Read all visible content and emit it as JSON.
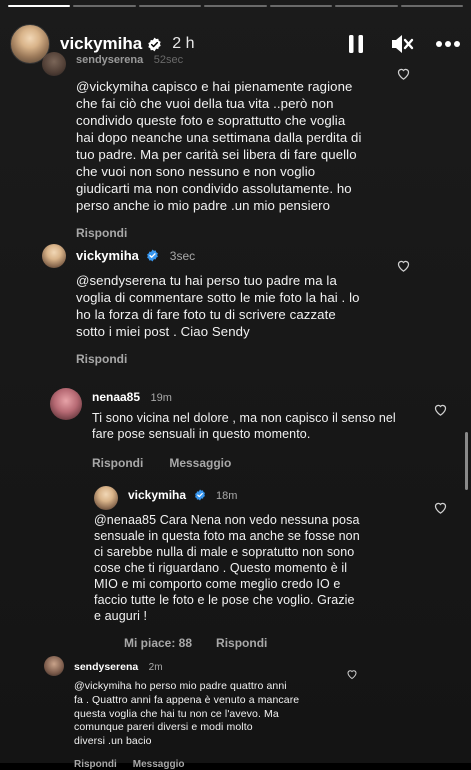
{
  "story": {
    "username": "vickymiha",
    "time": "2 h",
    "progress_segments": 7,
    "progress_current": 1
  },
  "comments": [
    {
      "user": "sendyserena",
      "time": "52sec",
      "text": "@vickymiha capisco e hai pienamente ragione\nche fai ciò che vuoi della tua vita ..però non\ncondivido queste foto e soprattutto che voglia\nhai dopo neanche una settimana dalla perdita di\ntuo padre. Ma per carità sei libera di fare quello\nche vuoi non sono nessuno e non voglio\ngiudicarti ma non condivido assolutamente. ho\nperso anche io mio padre .un mio pensiero",
      "reply_label": "Rispondi"
    },
    {
      "user": "vickymiha",
      "time": "3sec",
      "text": "@sendyserena tu hai perso tuo padre ma la\nvoglia di commentare sotto le mie foto la hai . lo\nho la forza di fare foto tu di scrivere cazzate\nsotto i miei post . Ciao Sendy",
      "reply_label": "Rispondi"
    },
    {
      "user": "nenaa85",
      "time": "19m",
      "text": "Ti sono vicina nel dolore , ma non capisco il senso nel\nfare pose sensuali in questo momento.",
      "reply_label": "Rispondi",
      "message_label": "Messaggio"
    },
    {
      "user": "vickymiha",
      "time": "18m",
      "text": "@nenaa85 Cara Nena non vedo nessuna posa\nsensuale in questa foto ma anche se fosse non\nci sarebbe nulla di male e sopratutto non sono\ncose che ti riguardano . Questo momento è il\nMIO e mi comporto come meglio credo IO e\nfaccio tutte le foto e le pose che voglio. Grazie\ne auguri !",
      "likes_label": "Mi piace: 88",
      "reply_label": "Rispondi"
    },
    {
      "user": "sendyserena",
      "time": "2m",
      "text": "@vickymiha ho perso mio padre quattro anni\nfa . Quattro anni fa appena è venuto a mancare\nquesta voglia che hai tu non ce l'avevo. Ma\ncomunque pareri diversi e modi molto\ndiversi .un bacio",
      "reply_label": "Rispondi",
      "message_label": "Messaggio"
    }
  ],
  "colors": {
    "verified": "#3897f0",
    "secondary_text": "#a8a8a8"
  }
}
